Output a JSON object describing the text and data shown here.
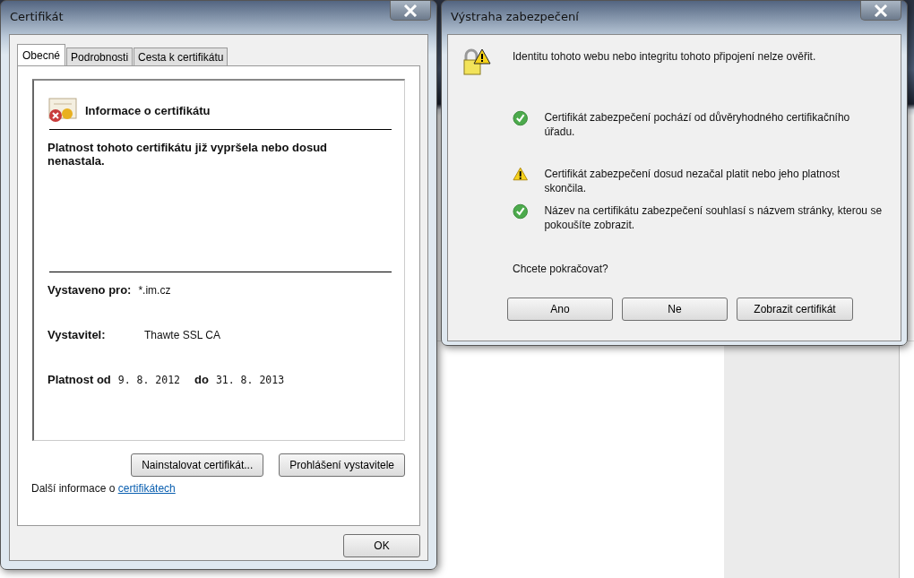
{
  "certificate_window": {
    "title": "Certifikát",
    "tabs": [
      {
        "label": "Obecné",
        "selected": true
      },
      {
        "label": "Podrobnosti",
        "selected": false
      },
      {
        "label": "Cesta k certifikátu",
        "selected": false
      }
    ],
    "heading": "Informace o certifikátu",
    "status": "Platnost tohoto certifikátu již vypršela nebo dosud nenastala.",
    "issued_to": {
      "label": "Vystaveno pro:",
      "value": "*.im.cz"
    },
    "issuer": {
      "label": "Vystavitel:",
      "value": "Thawte SSL CA"
    },
    "validity": {
      "from_label": "Platnost od",
      "from": "9. 8. 2012",
      "to_label": "do",
      "to": "31. 8. 2013"
    },
    "buttons": [
      "Nainstalovat certifikát...",
      "Prohlášení vystavitele"
    ],
    "info_text": "Další informace o",
    "info_link": "certifikátech",
    "ok_button": "OK"
  },
  "security_warning": {
    "title": "Výstraha zabezpečení",
    "message": "Identitu tohoto webu nebo integritu tohoto připojení nelze ověřit.",
    "checks": [
      {
        "kind": "ok",
        "text": "Certifikát zabezpečení pochází od důvěryhodného certifikačního úřadu."
      },
      {
        "kind": "warning",
        "text": "Certifikát zabezpečení dosud nezačal platit nebo jeho platnost skončila."
      },
      {
        "kind": "ok",
        "text": "Název na certifikátu zabezpečení souhlasí s názvem stránky, kterou se pokoušíte zobrazit."
      }
    ],
    "question": "Chcete pokračovat?",
    "buttons": [
      "Ano",
      "Ne",
      "Zobrazit certifikát"
    ]
  }
}
